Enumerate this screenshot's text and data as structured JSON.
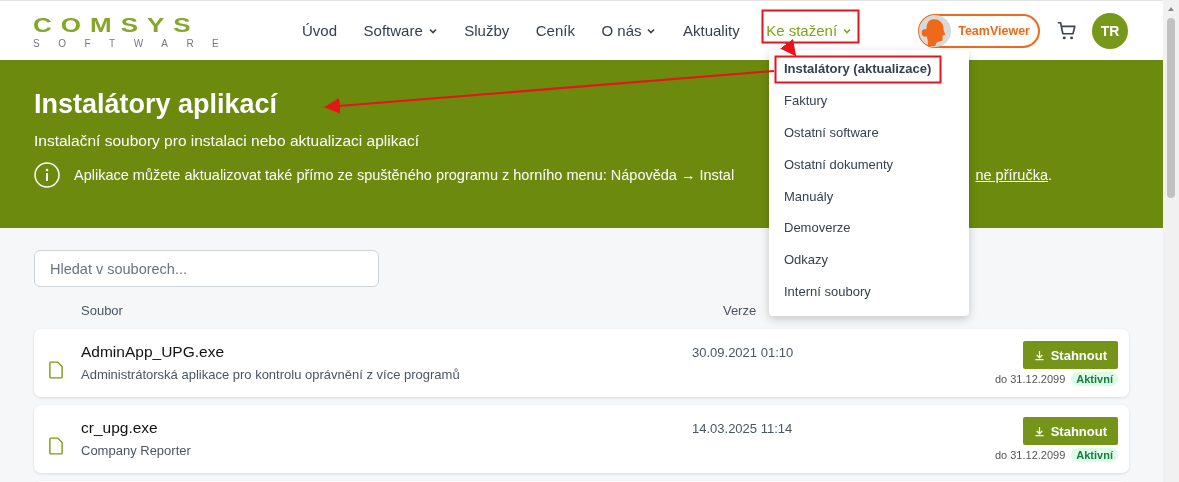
{
  "header": {
    "logo": {
      "name": "COMSYS",
      "tagline": "SOFTWARE"
    },
    "nav": [
      {
        "label": "Úvod",
        "has_menu": false,
        "selected": false
      },
      {
        "label": "Software",
        "has_menu": true,
        "selected": false
      },
      {
        "label": "Služby",
        "has_menu": false,
        "selected": false
      },
      {
        "label": "Ceník",
        "has_menu": false,
        "selected": false
      },
      {
        "label": "O nás",
        "has_menu": true,
        "selected": false
      },
      {
        "label": "Aktuality",
        "has_menu": false,
        "selected": false
      },
      {
        "label": "Ke stažení",
        "has_menu": true,
        "selected": true
      }
    ],
    "teamviewer": "TeamViewer",
    "avatar": "TR"
  },
  "dropdown": [
    {
      "label": "Instalátory (aktualizace)",
      "selected": true
    },
    {
      "label": "Faktury",
      "selected": false
    },
    {
      "label": "Ostatní software",
      "selected": false
    },
    {
      "label": "Ostatní dokumenty",
      "selected": false
    },
    {
      "label": "Manuály",
      "selected": false
    },
    {
      "label": "Demoverze",
      "selected": false
    },
    {
      "label": "Odkazy",
      "selected": false
    },
    {
      "label": "Interní soubory",
      "selected": false
    }
  ],
  "banner": {
    "title": "Instalátory aplikací",
    "subtitle": "Instalační soubory pro instalaci nebo aktualizaci aplikací",
    "info": {
      "text": "Aplikace můžete aktualizovat také přímo ze spuštěného programu z horního menu: Nápověda → Instal",
      "link": "ne příručka",
      "suffix": "."
    }
  },
  "search": {
    "placeholder": "Hledat v souborech..."
  },
  "columns": [
    "Soubor",
    "Verze"
  ],
  "files": [
    {
      "name": "AdminApp_UPG.exe",
      "description": "Administrátorská aplikace pro kontrolu oprávnění z více programů",
      "version": "30.09.2021 01:10",
      "button": "Stahnout",
      "expires": "do 31.12.2099",
      "status": "Aktivní"
    },
    {
      "name": "cr_upg.exe",
      "description": "Company Reporter",
      "version": "14.03.2025 11:14",
      "button": "Stahnout",
      "expires": "do 31.12.2099",
      "status": "Aktivní"
    }
  ]
}
